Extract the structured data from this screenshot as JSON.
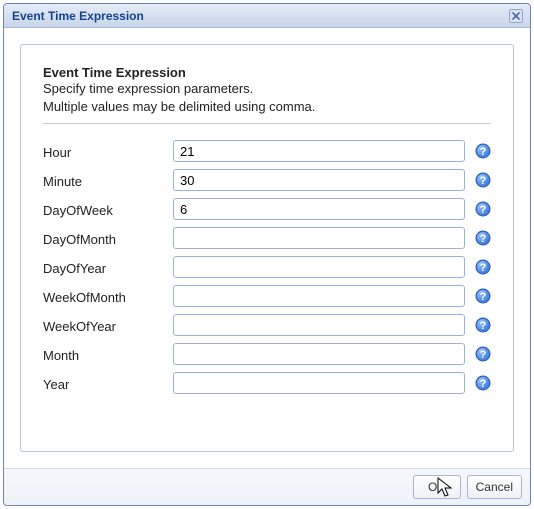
{
  "dialog": {
    "title": "Event Time Expression"
  },
  "heading": {
    "title": "Event Time Expression",
    "description": "Specify time expression parameters.\nMultiple values may be delimited using comma."
  },
  "fields": [
    {
      "key": "hour",
      "label": "Hour",
      "value": "21"
    },
    {
      "key": "minute",
      "label": "Minute",
      "value": "30"
    },
    {
      "key": "dayofweek",
      "label": "DayOfWeek",
      "value": "6"
    },
    {
      "key": "dayofmonth",
      "label": "DayOfMonth",
      "value": ""
    },
    {
      "key": "dayofyear",
      "label": "DayOfYear",
      "value": ""
    },
    {
      "key": "weekofmonth",
      "label": "WeekOfMonth",
      "value": ""
    },
    {
      "key": "weekofyear",
      "label": "WeekOfYear",
      "value": ""
    },
    {
      "key": "month",
      "label": "Month",
      "value": ""
    },
    {
      "key": "year",
      "label": "Year",
      "value": ""
    }
  ],
  "buttons": {
    "ok": "OK",
    "cancel": "Cancel"
  }
}
